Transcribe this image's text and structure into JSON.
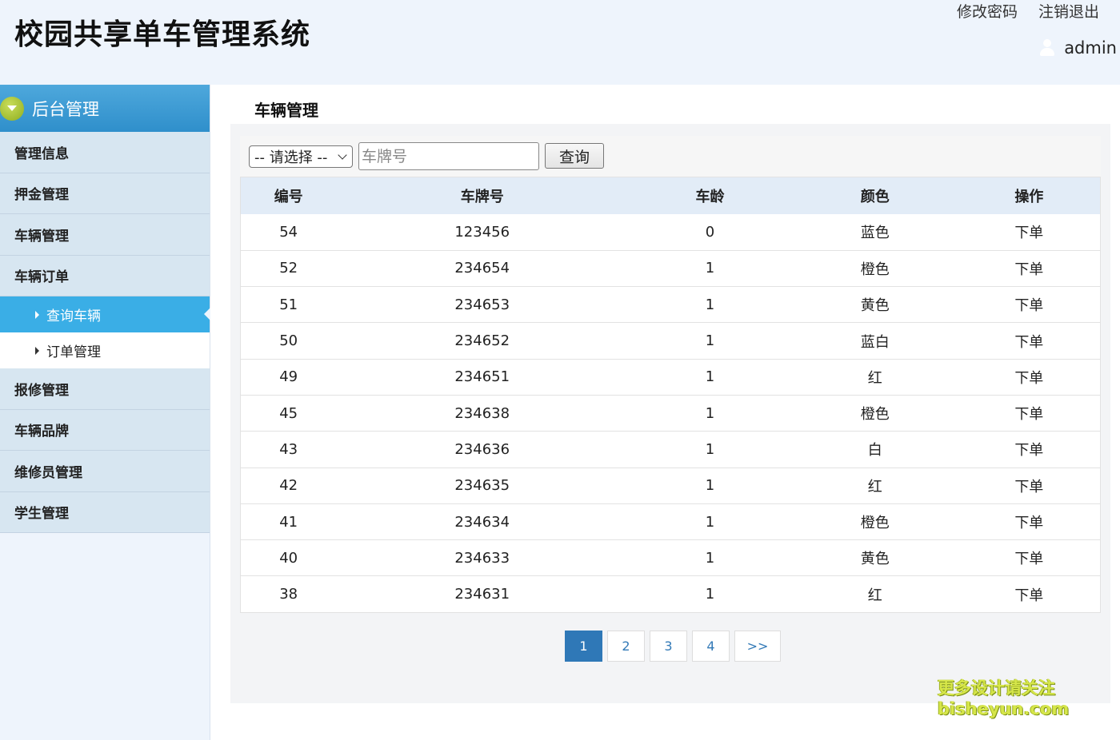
{
  "header": {
    "title": "校园共享单车管理系统",
    "links": [
      "修改密码",
      "注销退出"
    ],
    "user": "admin"
  },
  "sidebar": {
    "title": "后台管理",
    "items": [
      {
        "label": "管理信息"
      },
      {
        "label": "押金管理"
      },
      {
        "label": "车辆管理"
      },
      {
        "label": "车辆订单"
      }
    ],
    "subitems": [
      {
        "label": "查询车辆",
        "active": true
      },
      {
        "label": "订单管理",
        "active": false
      }
    ],
    "items_after": [
      {
        "label": "报修管理"
      },
      {
        "label": "车辆品牌"
      },
      {
        "label": "维修员管理"
      },
      {
        "label": "学生管理"
      }
    ]
  },
  "main": {
    "title": "车辆管理",
    "filter": {
      "select_value": "-- 请选择 --",
      "plate_placeholder": "车牌号",
      "query_label": "查询"
    },
    "table": {
      "headers": [
        "编号",
        "车牌号",
        "车龄",
        "颜色",
        "操作"
      ],
      "rows": [
        [
          "54",
          "123456",
          "0",
          "蓝色",
          "下单"
        ],
        [
          "52",
          "234654",
          "1",
          "橙色",
          "下单"
        ],
        [
          "51",
          "234653",
          "1",
          "黄色",
          "下单"
        ],
        [
          "50",
          "234652",
          "1",
          "蓝白",
          "下单"
        ],
        [
          "49",
          "234651",
          "1",
          "红",
          "下单"
        ],
        [
          "45",
          "234638",
          "1",
          "橙色",
          "下单"
        ],
        [
          "43",
          "234636",
          "1",
          "白",
          "下单"
        ],
        [
          "42",
          "234635",
          "1",
          "红",
          "下单"
        ],
        [
          "41",
          "234634",
          "1",
          "橙色",
          "下单"
        ],
        [
          "40",
          "234633",
          "1",
          "黄色",
          "下单"
        ],
        [
          "38",
          "234631",
          "1",
          "红",
          "下单"
        ]
      ]
    },
    "pagination": {
      "pages": [
        "1",
        "2",
        "3",
        "4"
      ],
      "current": "1",
      "next": ">>"
    }
  },
  "watermark": {
    "line1": "更多设计请关注",
    "line2": "bisheyun.com"
  },
  "colors": {
    "header_bg": "#eef4fc",
    "sidebar_active": "#3aaee6",
    "pager_active": "#2f78b7"
  }
}
